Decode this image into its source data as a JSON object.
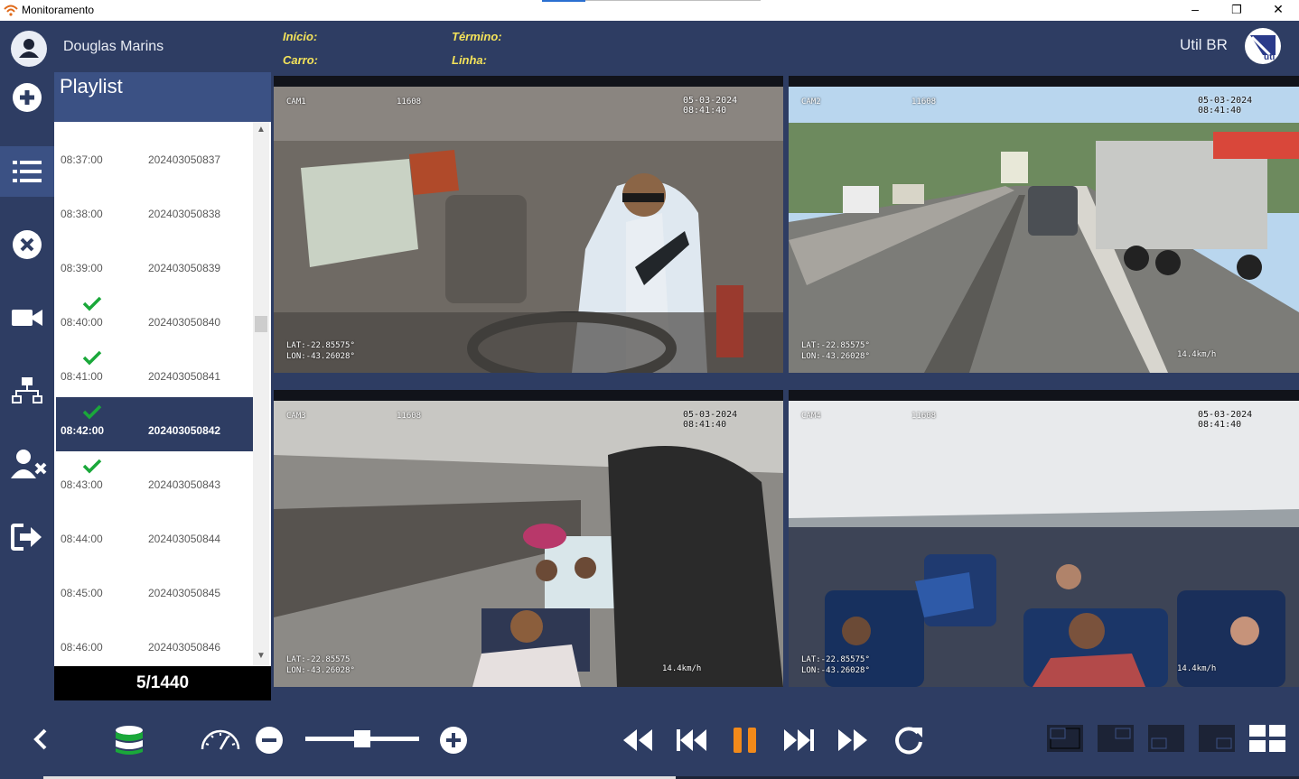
{
  "window": {
    "title": "Monitoramento",
    "minimize": "–",
    "maximize": "❐",
    "close": "✕"
  },
  "header": {
    "user_name": "Douglas Marins",
    "inicio_label": "Início:",
    "termino_label": "Término:",
    "carro_label": "Carro:",
    "linha_label": "Linha:",
    "company": "Util BR",
    "logo_text": "uti"
  },
  "sidebar": {
    "items": [
      {
        "name": "add",
        "icon": "plus-circle-icon"
      },
      {
        "name": "playlist",
        "icon": "list-icon",
        "active": true
      },
      {
        "name": "remove",
        "icon": "close-circle-icon"
      },
      {
        "name": "camera",
        "icon": "video-camera-icon"
      },
      {
        "name": "network",
        "icon": "network-icon"
      },
      {
        "name": "remove-user",
        "icon": "user-remove-icon"
      },
      {
        "name": "logout",
        "icon": "logout-icon"
      }
    ]
  },
  "playlist": {
    "title": "Playlist",
    "items": [
      {
        "time": "08:37:00",
        "file": "202403050837",
        "checked": false
      },
      {
        "time": "08:38:00",
        "file": "202403050838",
        "checked": false
      },
      {
        "time": "08:39:00",
        "file": "202403050839",
        "checked": false
      },
      {
        "time": "08:40:00",
        "file": "202403050840",
        "checked": true
      },
      {
        "time": "08:41:00",
        "file": "202403050841",
        "checked": true
      },
      {
        "time": "08:42:00",
        "file": "202403050842",
        "checked": true,
        "selected": true
      },
      {
        "time": "08:43:00",
        "file": "202403050843",
        "checked": true
      },
      {
        "time": "08:44:00",
        "file": "202403050844",
        "checked": false
      },
      {
        "time": "08:45:00",
        "file": "202403050845",
        "checked": false
      },
      {
        "time": "08:46:00",
        "file": "202403050846",
        "checked": false
      }
    ],
    "counter": "5/1440"
  },
  "cameras": [
    {
      "id": "CAM1",
      "car": "11608",
      "datetime": "05-03-2024 08:41:40",
      "lat": "LAT:-22.85575°",
      "lon": "LON:-43.26028°",
      "speed": ""
    },
    {
      "id": "CAM2",
      "car": "11608",
      "datetime": "05-03-2024 08:41:40",
      "lat": "LAT:-22.85575°",
      "lon": "LON:-43.26028°",
      "speed": "14.4km/h"
    },
    {
      "id": "CAM3",
      "car": "11608",
      "datetime": "05-03-2024 08:41:40",
      "lat": "LAT:-22.85575",
      "lon": "LON:-43.26028°",
      "speed": "14.4km/h"
    },
    {
      "id": "CAM4",
      "car": "11608",
      "datetime": "05-03-2024 08:41:40",
      "lat": "LAT:-22.85575°",
      "lon": "LON:-43.26028°",
      "speed": "14.4km/h"
    }
  ],
  "controls": {
    "back": "back-chevron-icon",
    "database": "database-icon",
    "speed": "speedometer-icon",
    "playback_speed_fraction": 0.5,
    "pause_color": "#f28a1a",
    "accent": "#3b5184",
    "check_color": "#1aa83a"
  }
}
